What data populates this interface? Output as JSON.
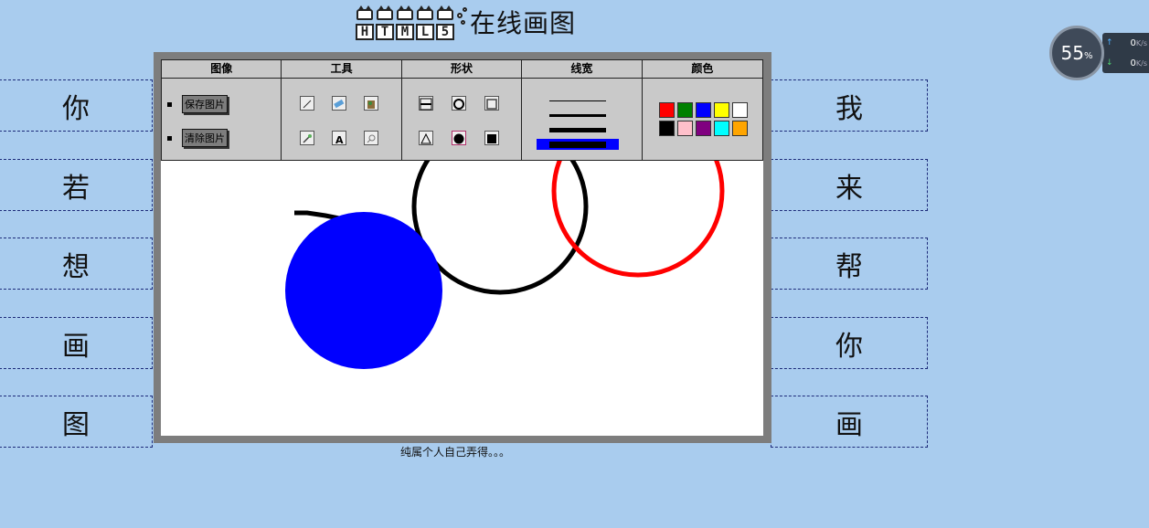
{
  "header": {
    "logo_letters": [
      "H",
      "T",
      "M",
      "L",
      "5"
    ],
    "title": "在线画图"
  },
  "left_words": [
    "你",
    "若",
    "想",
    "画",
    "图"
  ],
  "right_words": [
    "我",
    "来",
    "帮",
    "你",
    "画"
  ],
  "toolbar": {
    "image_panel": {
      "title": "图像",
      "save_label": "保存图片",
      "clear_label": "清除图片"
    },
    "tools_panel": {
      "title": "工具",
      "tools": [
        "pencil-icon",
        "eraser-icon",
        "paint-bucket-icon",
        "eyedropper-icon",
        "text-icon",
        "magnifier-icon"
      ]
    },
    "shapes_panel": {
      "title": "形状",
      "shapes": [
        "line-shape-icon",
        "circle-outline-icon",
        "rect-outline-icon",
        "triangle-outline-icon",
        "circle-fill-icon",
        "rect-fill-icon"
      ]
    },
    "line_width_panel": {
      "title": "线宽",
      "widths": [
        1,
        3,
        5,
        7
      ],
      "selected_index": 3
    },
    "color_panel": {
      "title": "颜色",
      "colors": [
        "#ff0000",
        "#008000",
        "#0000ff",
        "#ffff00",
        "#ffffff",
        "#000000",
        "#ffc0cb",
        "#800080",
        "#00ffff",
        "#ffa500"
      ]
    }
  },
  "canvas": {
    "shapes": [
      "blue-filled-circle",
      "black-circle",
      "red-circle",
      "black-stroke"
    ]
  },
  "footer": {
    "text": "纯属个人自己弄得。。。"
  },
  "net_widget": {
    "percent": "55",
    "percent_unit": "%",
    "upload": "0",
    "download": "0",
    "unit": "K/s",
    "upload_arrow": "↑",
    "download_arrow": "↓"
  }
}
